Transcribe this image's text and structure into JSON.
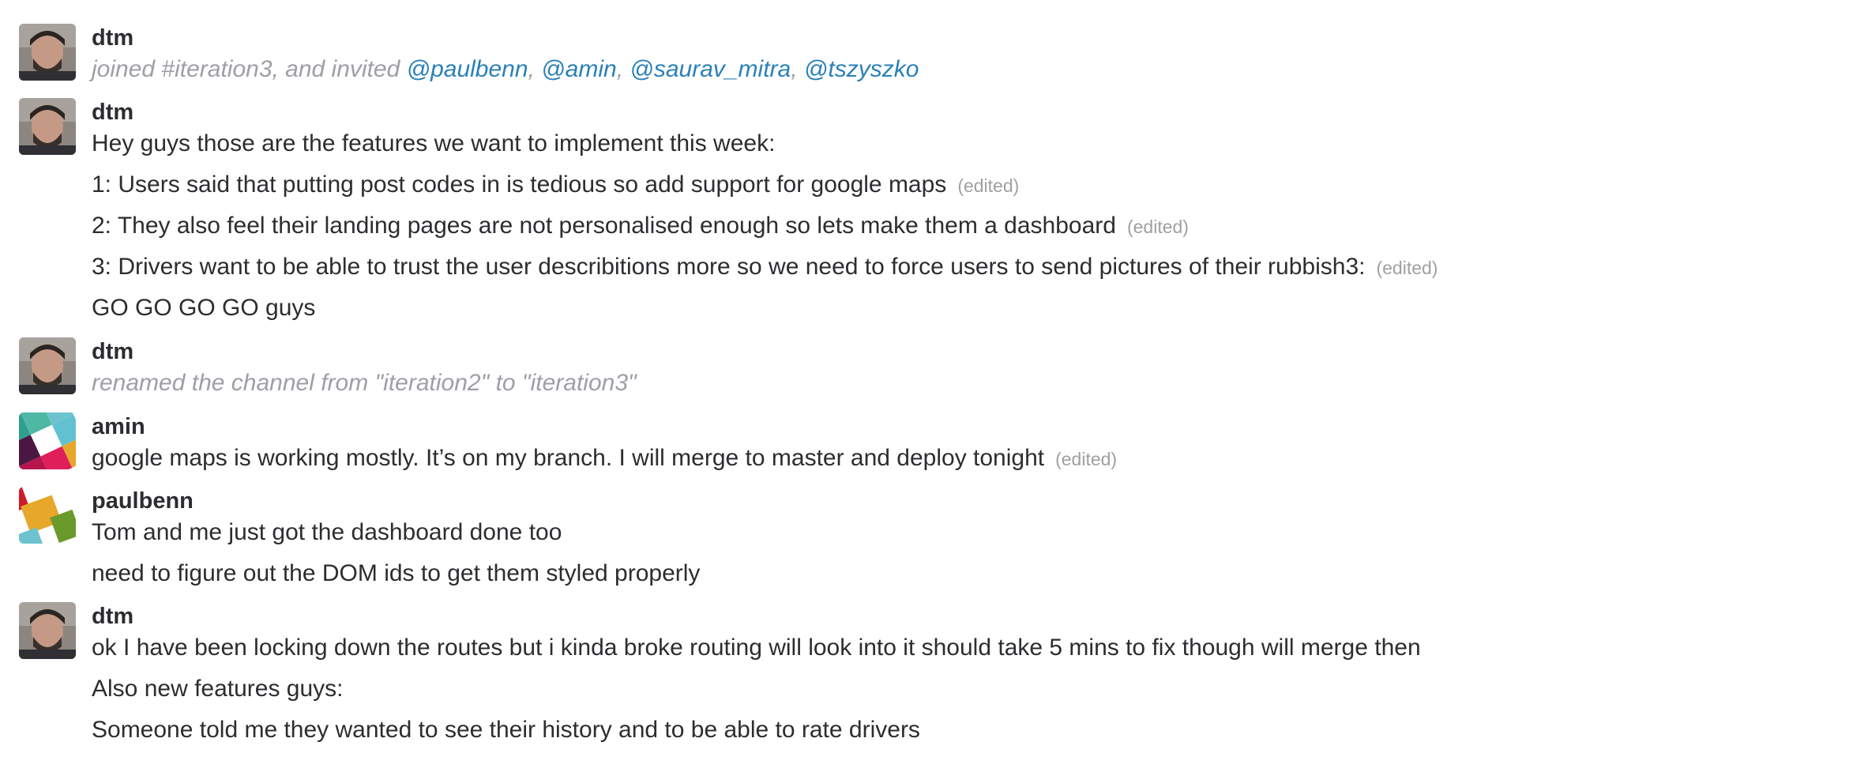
{
  "messages": [
    {
      "user": "dtm",
      "avatar": "dtm-avatar",
      "lines": [
        {
          "type": "join",
          "prefix": "joined #iteration3, and invited ",
          "mentions": [
            "@paulbenn",
            "@amin",
            "@saurav_mitra",
            "@tszyszko"
          ],
          "separator": ", "
        }
      ]
    },
    {
      "user": "dtm",
      "avatar": "dtm-avatar",
      "lines": [
        {
          "text": "Hey guys those are the features we want to implement this week:",
          "edited": ""
        },
        {
          "text": "1: Users said that putting post codes in is tedious so add support for google maps",
          "edited": "(edited)"
        },
        {
          "text": "2: They also feel their landing pages are not personalised enough so lets make them a dashboard",
          "edited": "(edited)"
        },
        {
          "text": "3: Drivers want to be able to trust the user describitions more so we need to force users to send pictures of their rubbish3:",
          "edited": "(edited)"
        },
        {
          "text": "GO GO GO GO guys",
          "edited": ""
        }
      ]
    },
    {
      "user": "dtm",
      "avatar": "dtm-avatar",
      "lines": [
        {
          "text": "renamed the channel from \"iteration2\" to \"iteration3\"",
          "meta": true
        }
      ]
    },
    {
      "user": "amin",
      "avatar": "amin-avatar",
      "lines": [
        {
          "text": "google maps is working mostly. It’s on my branch. I will merge to master and deploy tonight",
          "edited": "(edited)"
        }
      ]
    },
    {
      "user": "paulbenn",
      "avatar": "paulbenn-avatar",
      "lines": [
        {
          "text": "Tom and me just got the dashboard done too",
          "edited": ""
        },
        {
          "text": "need to figure out the DOM ids to get them styled properly",
          "edited": ""
        }
      ]
    },
    {
      "user": "dtm",
      "avatar": "dtm-avatar",
      "lines": [
        {
          "text": "ok I have been locking down the routes but i kinda broke routing will look into it should take 5 mins to fix though will merge then",
          "edited": ""
        },
        {
          "text": "Also new features guys:",
          "edited": ""
        },
        {
          "text": "Someone told me they wanted to see their history and to be able to rate drivers",
          "edited": ""
        }
      ]
    }
  ],
  "colors": {
    "text": "#2c2d30",
    "meta": "#9e9ea6",
    "mention": "#2a80b9",
    "edited": "#a0a0a2"
  }
}
